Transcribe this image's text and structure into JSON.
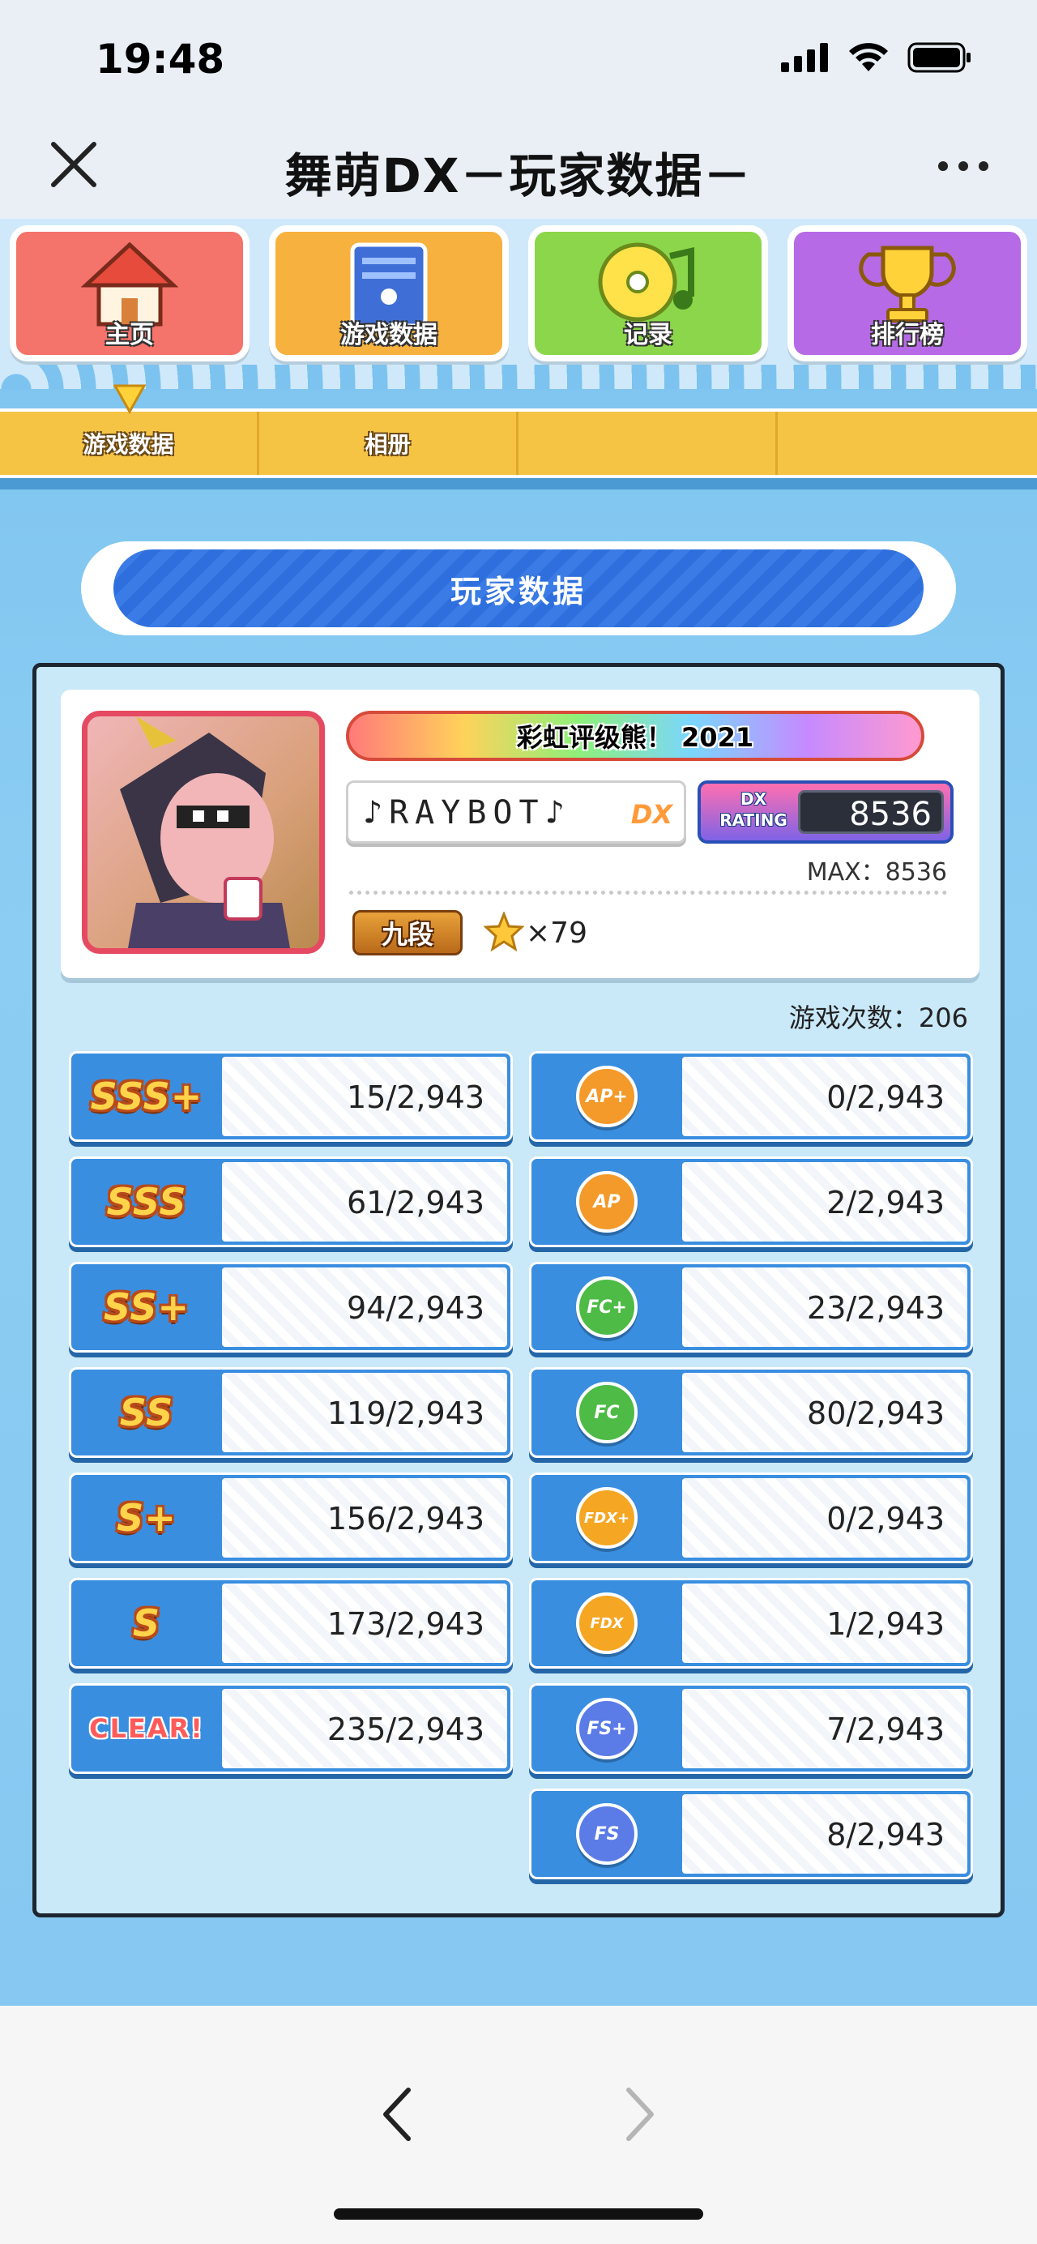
{
  "status_bar": {
    "time": "19:48"
  },
  "title_bar": {
    "title": "舞萌DX－玩家数据－"
  },
  "nav": {
    "tiles": [
      {
        "label": "主页",
        "color": "#f4736a"
      },
      {
        "label": "游戏数据",
        "color": "#f7b13e"
      },
      {
        "label": "记录",
        "color": "#8bd64a"
      },
      {
        "label": "排行榜",
        "color": "#b66ae6"
      }
    ]
  },
  "subtabs": [
    "游戏数据",
    "相册",
    "",
    ""
  ],
  "banner": {
    "title": "玩家数据"
  },
  "profile": {
    "title_plate": "彩虹评级熊！ 2021",
    "player_name": "♪RAYBOT♪",
    "dx_badge": "DX",
    "rating_label_top": "DX",
    "rating_label_bottom": "RATING",
    "rating": "8536",
    "max_rating": "MAX：8536",
    "dan": "九段",
    "star_count": "×79"
  },
  "play_count": "游戏次数：206",
  "rank_stats": [
    {
      "rank": "SSS+",
      "value": "15/2,943"
    },
    {
      "rank": "SSS",
      "value": "61/2,943"
    },
    {
      "rank": "SS+",
      "value": "94/2,943"
    },
    {
      "rank": "SS",
      "value": "119/2,943"
    },
    {
      "rank": "S+",
      "value": "156/2,943"
    },
    {
      "rank": "S",
      "value": "173/2,943"
    },
    {
      "rank": "CLEAR!",
      "value": "235/2,943"
    }
  ],
  "combo_stats": [
    {
      "badge": "AP+",
      "value": "0/2,943",
      "color": "#f39a2a"
    },
    {
      "badge": "AP",
      "value": "2/2,943",
      "color": "#f39a2a"
    },
    {
      "badge": "FC+",
      "value": "23/2,943",
      "color": "#4dbb45"
    },
    {
      "badge": "FC",
      "value": "80/2,943",
      "color": "#4dbb45"
    },
    {
      "badge": "FDX+",
      "value": "0/2,943",
      "color": "#f5a623"
    },
    {
      "badge": "FDX",
      "value": "1/2,943",
      "color": "#f5a623"
    },
    {
      "badge": "FS+",
      "value": "7/2,943",
      "color": "#5b7be6"
    },
    {
      "badge": "FS",
      "value": "8/2,943",
      "color": "#5b7be6"
    }
  ]
}
